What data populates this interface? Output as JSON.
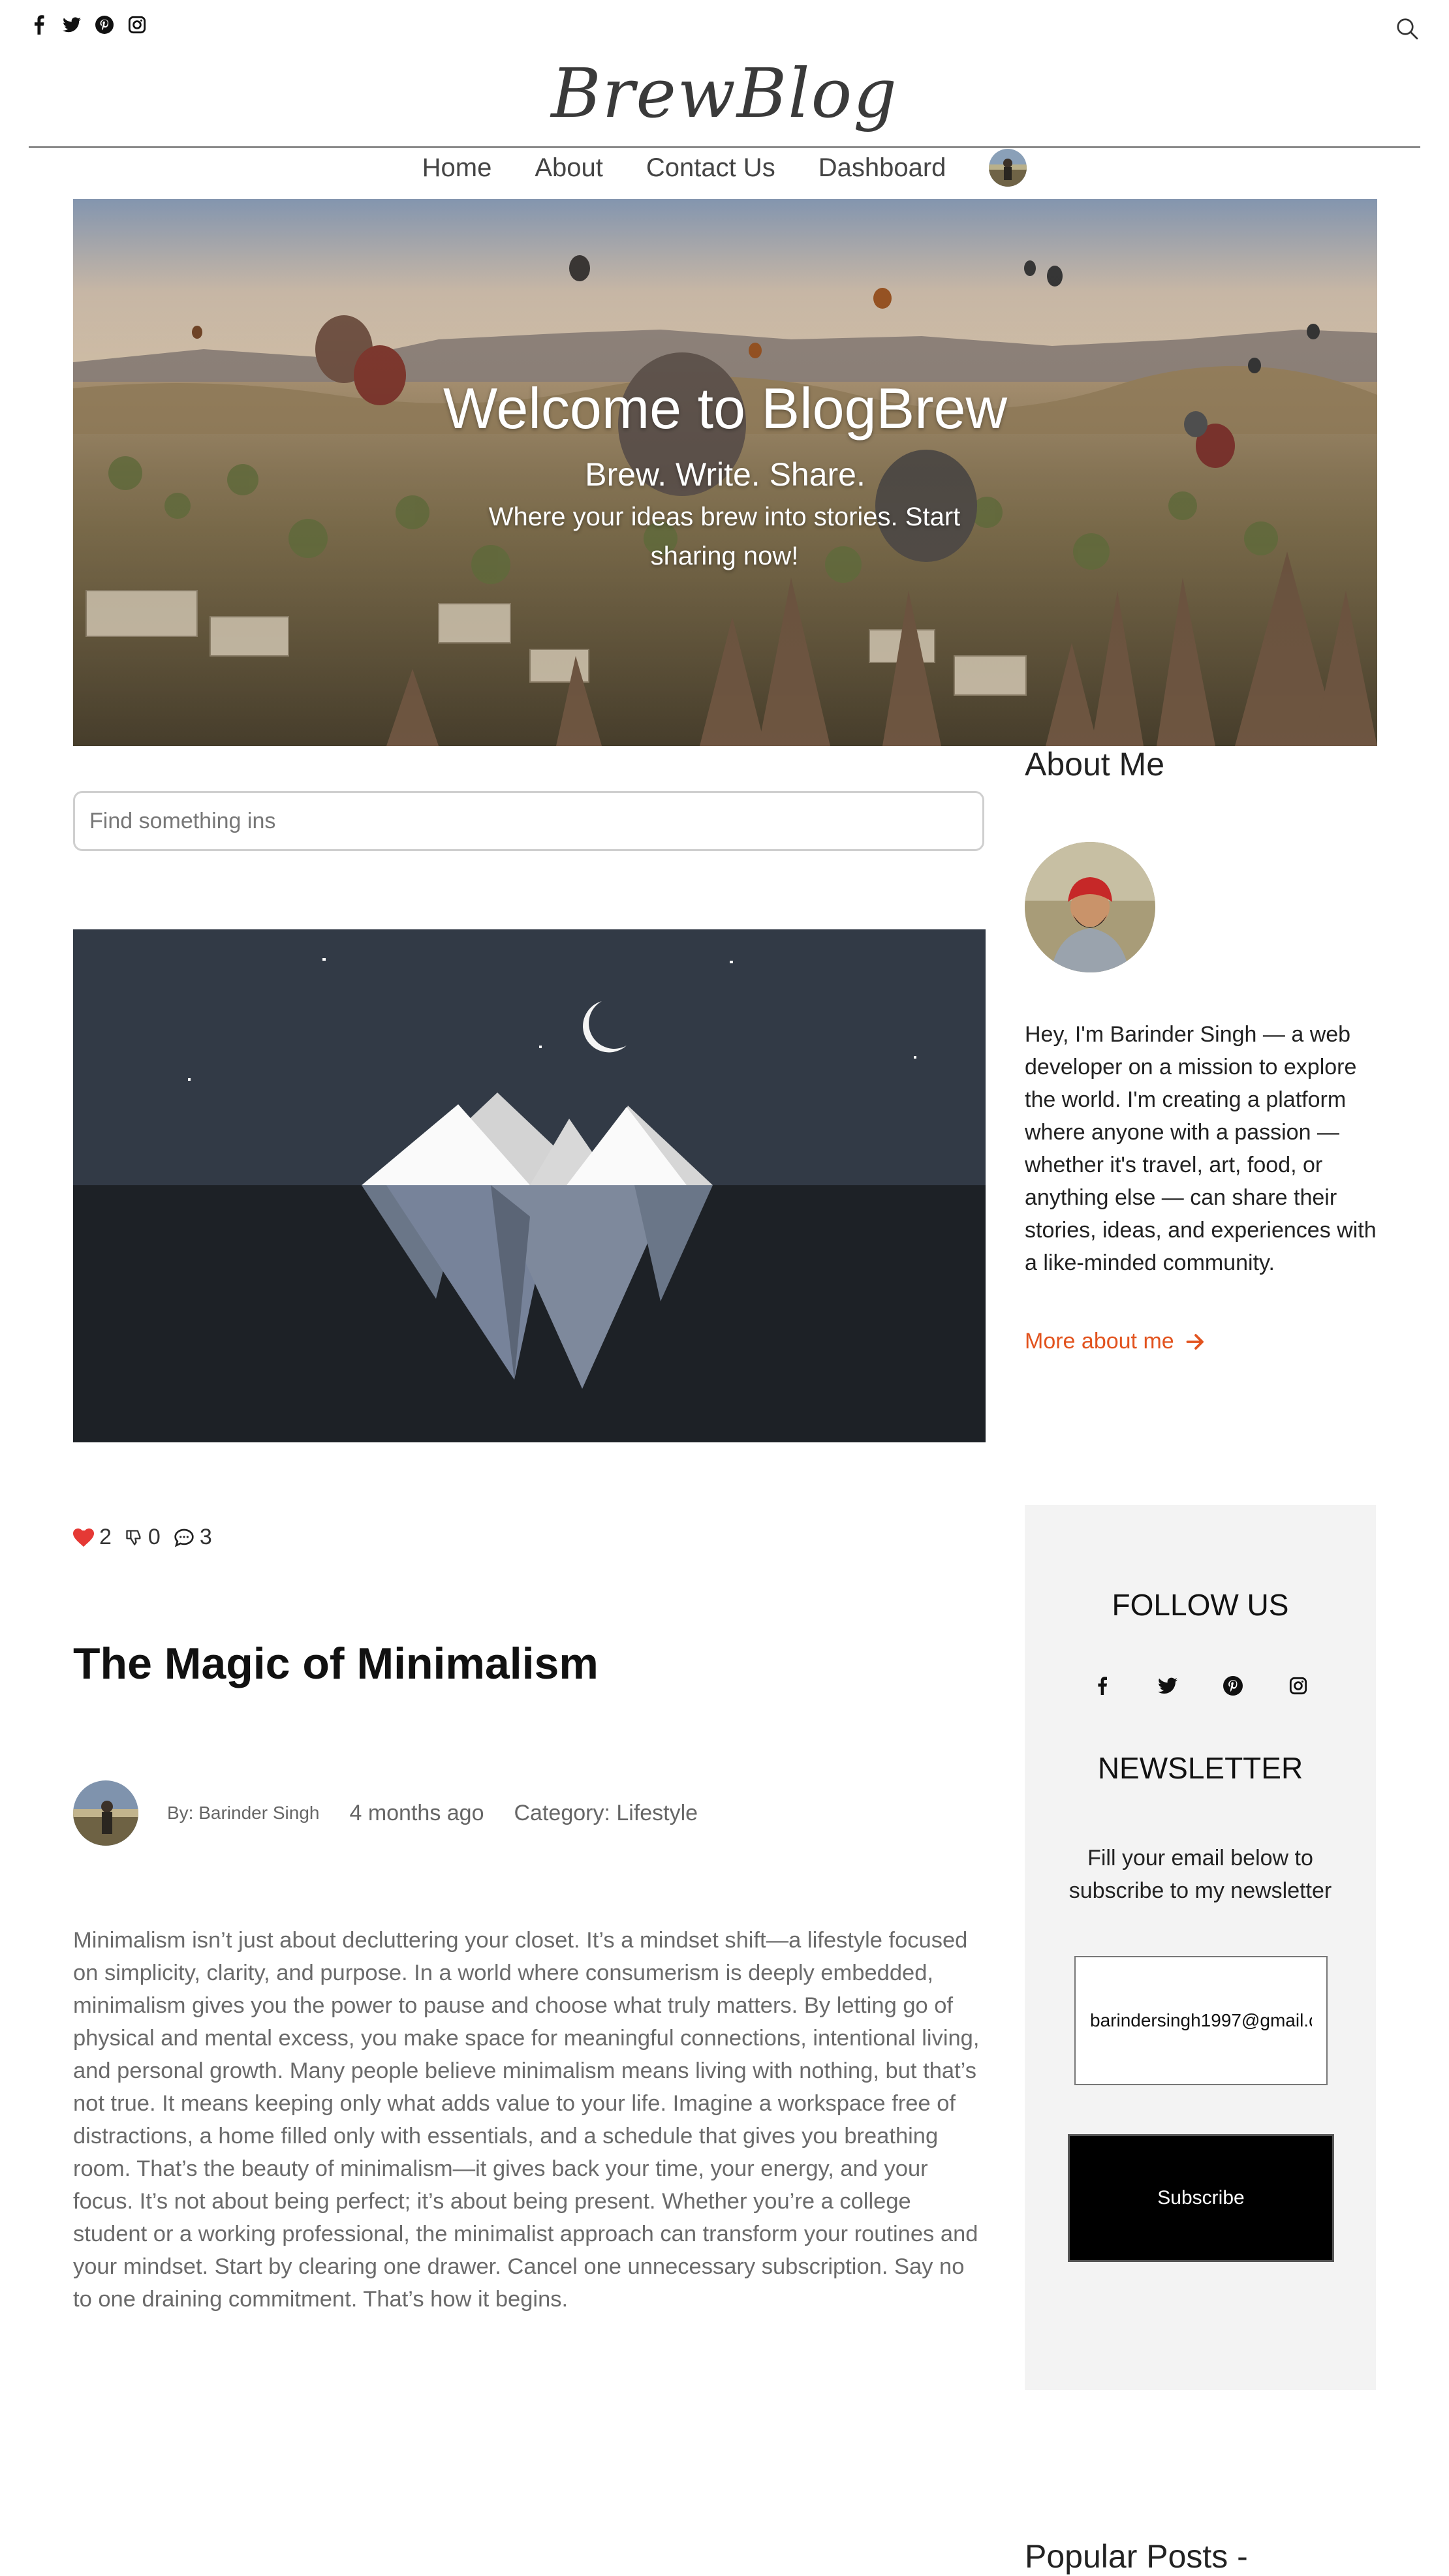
{
  "header": {
    "social_icons": [
      "facebook-icon",
      "twitter-icon",
      "pinterest-icon",
      "instagram-icon"
    ],
    "search_icon": "search-icon",
    "logo": "BrewBlog"
  },
  "nav": {
    "items": [
      "Home",
      "About",
      "Contact Us",
      "Dashboard"
    ],
    "avatar": "user-avatar"
  },
  "hero": {
    "title": "Welcome to BlogBrew",
    "subtitle": "Brew. Write. Share.",
    "description": "Where your ideas brew into stories. Start sharing now!"
  },
  "search": {
    "placeholder": "Find something ins"
  },
  "post": {
    "likes": "2",
    "dislikes": "0",
    "comments": "3",
    "title": "The Magic of Minimalism",
    "author": "By: Barinder Singh",
    "time": "4 months ago",
    "category": "Category: Lifestyle",
    "body": "Minimalism isn’t just about decluttering your closet. It’s a mindset shift—a lifestyle focused on simplicity, clarity, and purpose. In a world where consumerism is deeply embedded, minimalism gives you the power to pause and choose what truly matters. By letting go of physical and mental excess, you make space for meaningful connections, intentional living, and personal growth. Many people believe minimalism means living with nothing, but that’s not true. It means keeping only what adds value to your life. Imagine a workspace free of distractions, a home filled only with essentials, and a schedule that gives you breathing room. That’s the beauty of minimalism—it gives back your time, your energy, and your focus. It’s not about being perfect; it’s about being present. Whether you’re a college student or a working professional, the minimalist approach can transform your routines and your mindset. Start by clearing one drawer. Cancel one unnecessary subscription. Say no to one draining commitment. That’s how it begins."
  },
  "sidebar": {
    "about_title": "About Me",
    "about_text": "Hey, I'm Barinder Singh — a web developer on a mission to explore the world. I'm creating a platform where anyone with a passion — whether it's travel, art, food, or anything else — can share their stories, ideas, and experiences with a like-minded community.",
    "about_link": "More about me",
    "follow_title": "FOLLOW US",
    "newsletter_title": "NEWSLETTER",
    "newsletter_desc": "Fill your email below to subscribe to my newsletter",
    "email_value": "barindersingh1997@gmail.c",
    "subscribe_label": "Subscribe",
    "popular_title": "Popular Posts -"
  },
  "colors": {
    "accent": "#e2531e",
    "heart": "#e53935",
    "follow_bg": "#f3f3f3"
  }
}
